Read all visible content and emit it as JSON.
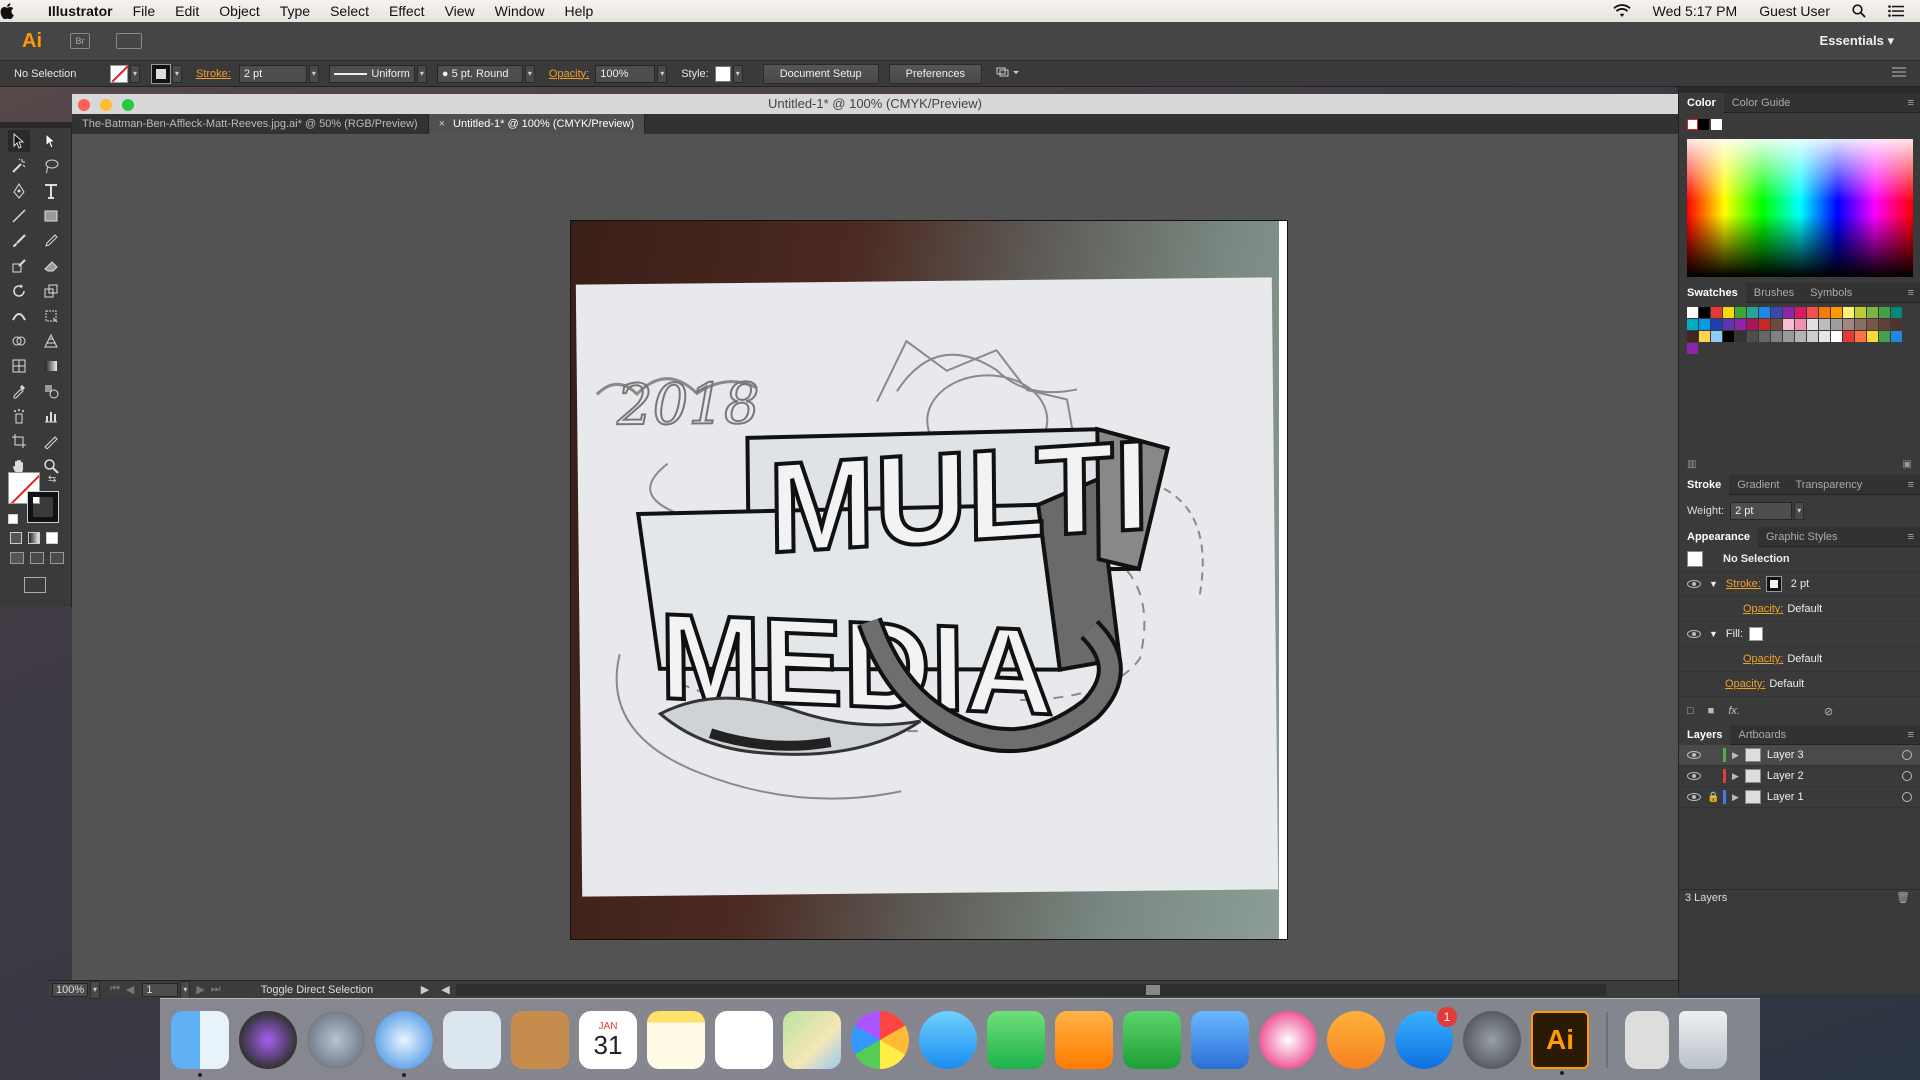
{
  "menubar": {
    "app_name": "Illustrator",
    "items": [
      "File",
      "Edit",
      "Object",
      "Type",
      "Select",
      "Effect",
      "View",
      "Window",
      "Help"
    ],
    "clock": "Wed 5:17 PM",
    "user": "Guest User"
  },
  "appbar": {
    "logo": "Ai",
    "bridge": "Br",
    "workspace": "Essentials"
  },
  "control": {
    "selection": "No Selection",
    "stroke_label": "Stroke:",
    "stroke_weight": "2 pt",
    "profile": "Uniform",
    "brush": "5 pt. Round",
    "opacity_label": "Opacity:",
    "opacity_value": "100%",
    "style_label": "Style:",
    "document_setup": "Document Setup",
    "preferences": "Preferences"
  },
  "document": {
    "window_title": "Untitled-1* @ 100% (CMYK/Preview)",
    "tabs": [
      {
        "label": "The-Batman-Ben-Affleck-Matt-Reeves.jpg.ai* @ 50% (RGB/Preview)",
        "active": false
      },
      {
        "label": "Untitled-1* @ 100% (CMYK/Preview)",
        "active": true
      }
    ],
    "artwork_text": [
      "MULTI",
      "MEDIA",
      "2018"
    ]
  },
  "status": {
    "zoom": "100%",
    "page": "1",
    "tool_hint": "Toggle Direct Selection"
  },
  "panels": {
    "color_tabs": [
      "Color",
      "Color Guide"
    ],
    "swatch_tabs": [
      "Swatches",
      "Brushes",
      "Symbols"
    ],
    "stroke_tabs": [
      "Stroke",
      "Gradient",
      "Transparency"
    ],
    "weight_label": "Weight:",
    "weight_value": "2 pt",
    "appearance_tabs": [
      "Appearance",
      "Graphic Styles"
    ],
    "appearance": {
      "title": "No Selection",
      "stroke_label": "Stroke:",
      "stroke_value": "2 pt",
      "opacity_label": "Opacity:",
      "opacity_value": "Default",
      "fill_label": "Fill:",
      "fx": "fx."
    },
    "layers_tabs": [
      "Layers",
      "Artboards"
    ],
    "layers": [
      {
        "name": "Layer 3",
        "color": "#4caf50",
        "locked": false
      },
      {
        "name": "Layer 2",
        "color": "#e53935",
        "locked": false
      },
      {
        "name": "Layer 1",
        "color": "#3f7fe0",
        "locked": true
      }
    ],
    "layers_count": "3 Layers"
  },
  "dock": {
    "calendar_month": "JAN",
    "calendar_day": "31",
    "appstore_badge": "1",
    "ai_label": "Ai",
    "icons": [
      "finder-icon",
      "siri-icon",
      "launchpad-icon",
      "safari-icon",
      "mail-icon",
      "contacts-icon",
      "calendar-icon",
      "notes-icon",
      "reminders-icon",
      "maps-icon",
      "photos-icon",
      "messages-icon",
      "facetime-icon",
      "pages-icon",
      "numbers-icon",
      "keynote-icon",
      "itunes-icon",
      "ibooks-icon",
      "appstore-icon",
      "system-preferences-icon",
      "illustrator-icon",
      "preview-icon",
      "trash-icon"
    ]
  },
  "colors": {
    "accent_orange": "#f0a030",
    "panel_bg": "#3a3a3a",
    "canvas_bg": "#535353"
  }
}
